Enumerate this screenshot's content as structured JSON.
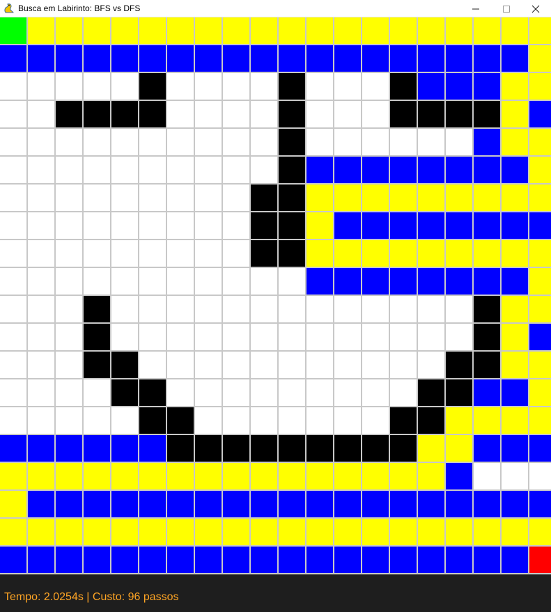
{
  "window": {
    "title": "Busca em Labirinto: BFS vs DFS",
    "controls": [
      "minimize-icon",
      "maximize-icon",
      "close-icon"
    ]
  },
  "maze": {
    "rows": 20,
    "cols": 20,
    "legend": {
      "W": "#ffffff",
      "B": "#000000",
      "Y": "#ffff00",
      "U": "#0000ff",
      "G": "#00ff00",
      "R": "#ff0000"
    },
    "grid_line_color": "#c8c8c8",
    "cells": [
      "GYYYYYYYYYYYYYYYYYYY",
      "UUUUUUUUUUUUUUUUUUUY",
      "WWWWWBWWWWBWWWBUUUYY",
      "WWBBBBWWWWBWWWBBBBYU",
      "WWWWWWWWWWBWWWWWWUYY",
      "WWWWWWWWWWBUUUUUUUUY",
      "WWWWWWWWWBBYYYYYYYYY",
      "WWWWWWWWWBBYUUUUUUUU",
      "WWWWWWWWWBBYYYYYYYYY",
      "WWWWWWWWWWWUUUUUUUUY",
      "WWWBWWWWWWWWWWWWWBYY",
      "WWWBWWWWWWWWWWWWWBYU",
      "WWWBBWWWWWWWWWWWBBYY",
      "WWWWBBWWWWWWWWWBBUUY",
      "WWWWWBBWWWWWWWBBYYYY",
      "UUUUUUBBBBBBBBBYYUUU",
      "YYYYYYYYYYYYYYYYUWWW",
      "YUUUUUUUUUUUUUUUUUUU",
      "YYYYYYYYYYYYYYYYYYYY",
      "UUUUUUUUUUUUUUUUUUUR"
    ]
  },
  "status": {
    "text": "Tempo: 2.0254s | Custo: 96 passos",
    "color": "#ffa524"
  }
}
